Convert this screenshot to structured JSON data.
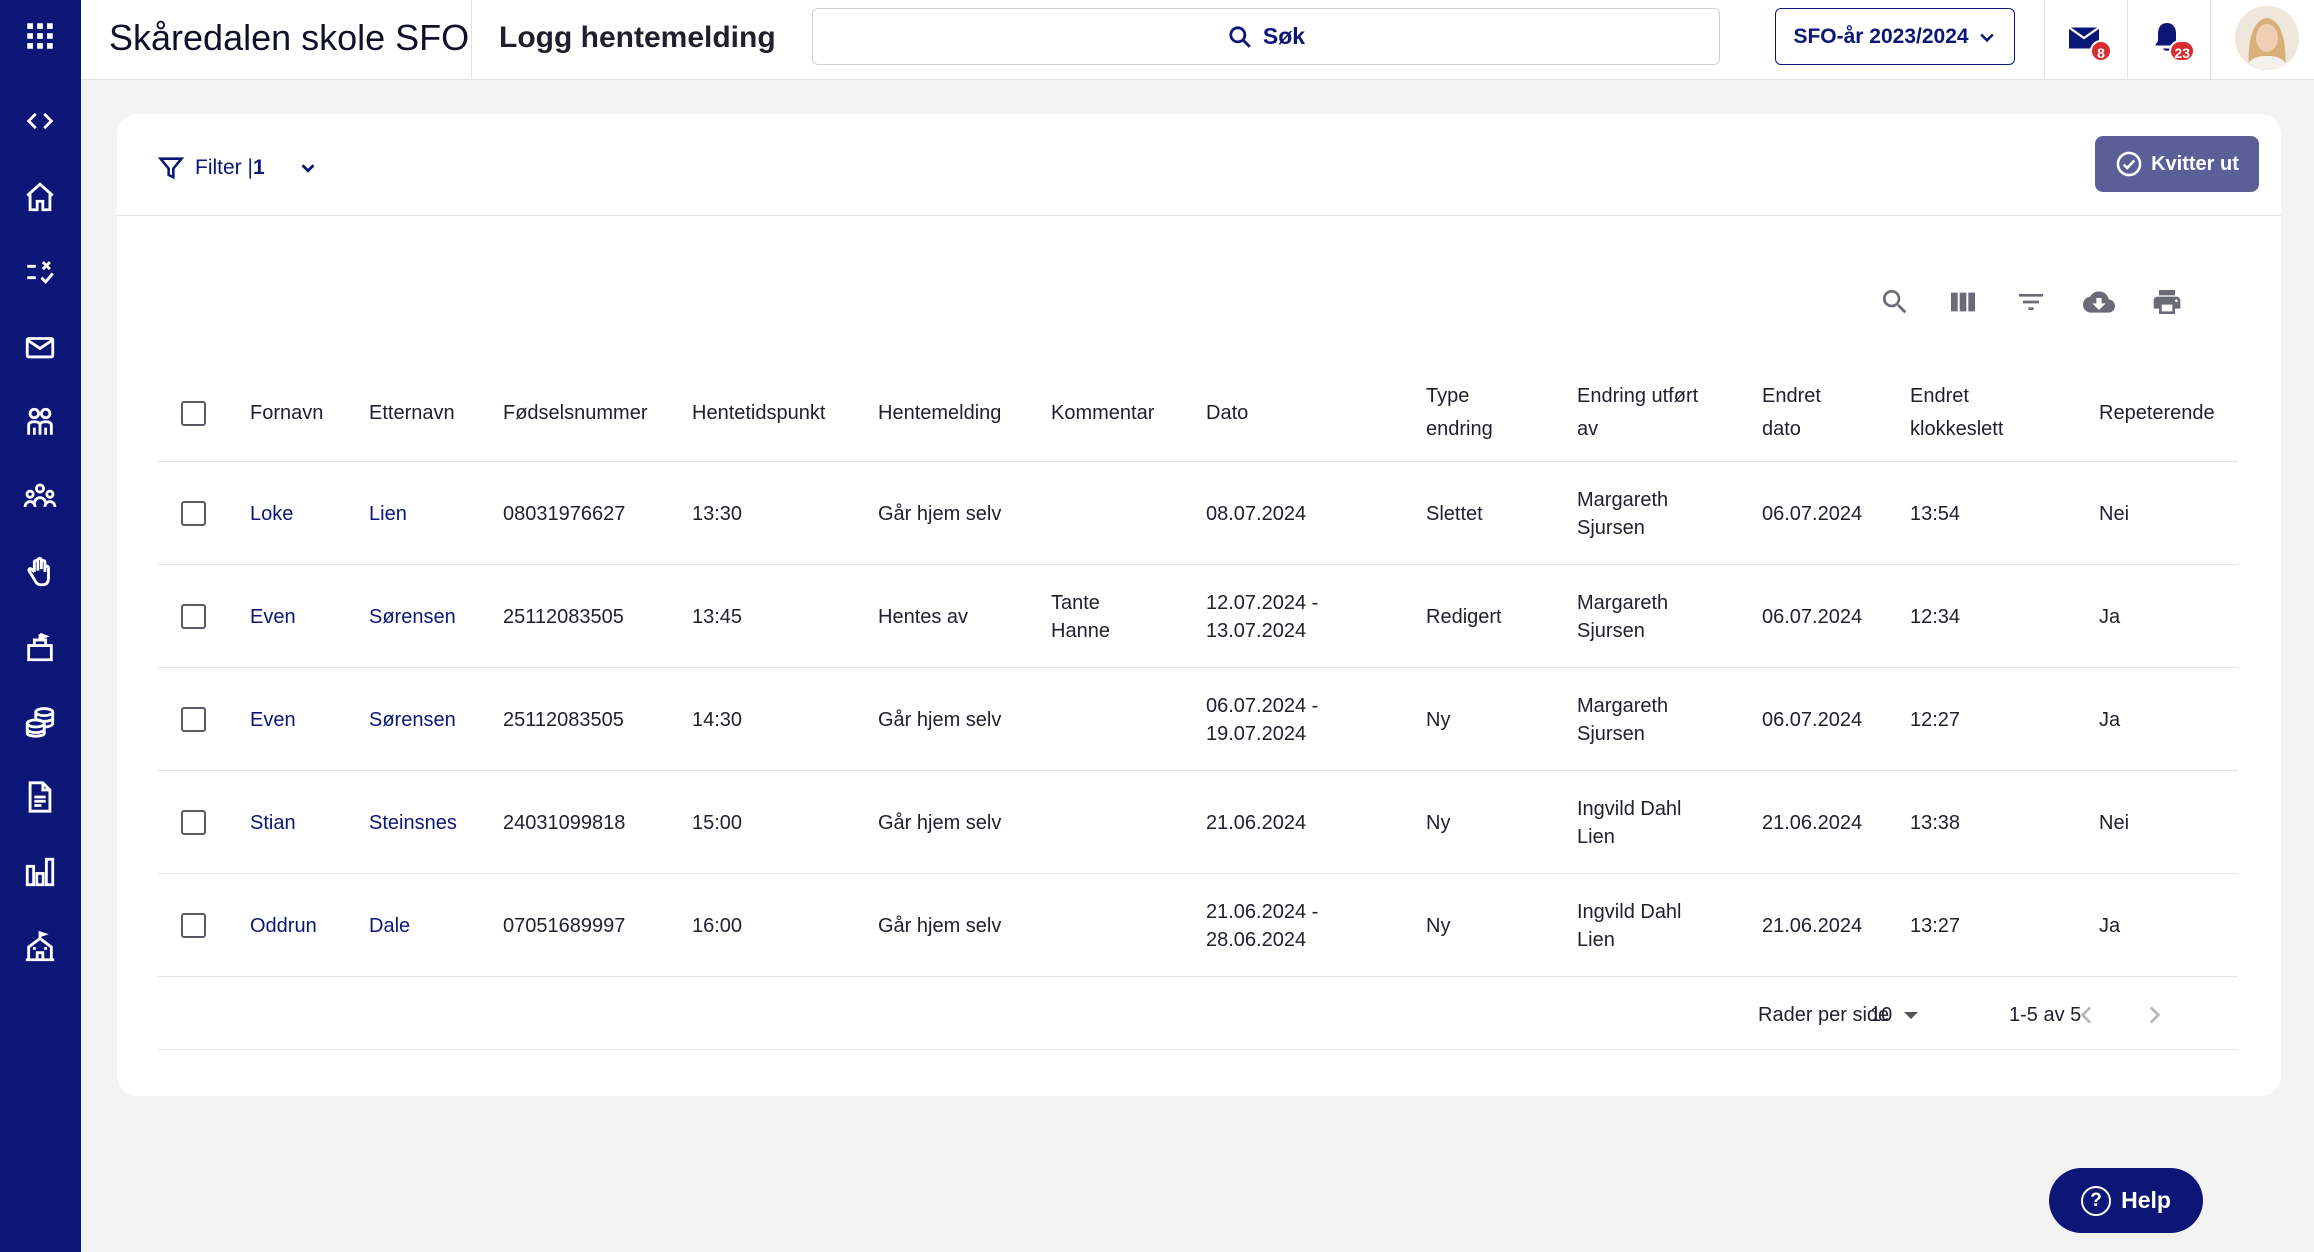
{
  "header": {
    "school_name": "Skåredalen skole SFO",
    "page_title": "Logg hentemelding",
    "search_label": "Søk",
    "year_selector": "SFO-år 2023/2024",
    "mail_badge": "8",
    "notifications_badge": "23"
  },
  "sidebar": {
    "items": [
      "expand-collapse",
      "home",
      "tasks",
      "messages",
      "children",
      "groups",
      "attendance",
      "departments",
      "payments",
      "documents",
      "reports",
      "school"
    ]
  },
  "toolbar": {
    "filter_label": "Filter |",
    "filter_count": "1",
    "kvitter_label": "Kvitter ut"
  },
  "table": {
    "columns": {
      "fornavn": "Fornavn",
      "etternavn": "Etternavn",
      "fodselsnummer": "Fødselsnummer",
      "hentetidspunkt": "Hentetidspunkt",
      "hentemelding": "Hentemelding",
      "kommentar": "Kommentar",
      "dato": "Dato",
      "type_endring": "Type endring",
      "endring_utfort_av": "Endring utført av",
      "endret_dato": "Endret dato",
      "endret_klokkeslett": "Endret klokkeslett",
      "repeterende": "Repeterende"
    },
    "rows": [
      {
        "fornavn": "Loke",
        "etternavn": "Lien",
        "fodselsnummer": "08031976627",
        "hentetidspunkt": "13:30",
        "hentemelding": "Går hjem selv",
        "kommentar": "",
        "dato": "08.07.2024",
        "type_endring": "Slettet",
        "endring_utfort_av": "Margareth Sjursen",
        "endret_dato": "06.07.2024",
        "endret_klokkeslett": "13:54",
        "repeterende": "Nei"
      },
      {
        "fornavn": "Even",
        "etternavn": "Sørensen",
        "fodselsnummer": "25112083505",
        "hentetidspunkt": "13:45",
        "hentemelding": "Hentes av",
        "kommentar": "Tante Hanne",
        "dato": "12.07.2024 - 13.07.2024",
        "type_endring": "Redigert",
        "endring_utfort_av": "Margareth Sjursen",
        "endret_dato": "06.07.2024",
        "endret_klokkeslett": "12:34",
        "repeterende": "Ja"
      },
      {
        "fornavn": "Even",
        "etternavn": "Sørensen",
        "fodselsnummer": "25112083505",
        "hentetidspunkt": "14:30",
        "hentemelding": "Går hjem selv",
        "kommentar": "",
        "dato": "06.07.2024 - 19.07.2024",
        "type_endring": "Ny",
        "endring_utfort_av": "Margareth Sjursen",
        "endret_dato": "06.07.2024",
        "endret_klokkeslett": "12:27",
        "repeterende": "Ja"
      },
      {
        "fornavn": "Stian",
        "etternavn": "Steinsnes",
        "fodselsnummer": "24031099818",
        "hentetidspunkt": "15:00",
        "hentemelding": "Går hjem selv",
        "kommentar": "",
        "dato": "21.06.2024",
        "type_endring": "Ny",
        "endring_utfort_av": "Ingvild Dahl Lien",
        "endret_dato": "21.06.2024",
        "endret_klokkeslett": "13:38",
        "repeterende": "Nei"
      },
      {
        "fornavn": "Oddrun",
        "etternavn": "Dale",
        "fodselsnummer": "07051689997",
        "hentetidspunkt": "16:00",
        "hentemelding": "Går hjem selv",
        "kommentar": "",
        "dato": "21.06.2024 - 28.06.2024",
        "type_endring": "Ny",
        "endring_utfort_av": "Ingvild Dahl Lien",
        "endret_dato": "21.06.2024",
        "endret_klokkeslett": "13:27",
        "repeterende": "Ja"
      }
    ]
  },
  "pagination": {
    "rows_per_page_label": "Rader per side",
    "rows_per_page_value": "10",
    "range": "1-5 av 5"
  },
  "help": {
    "label": "Help"
  },
  "colors": {
    "brand_navy": "#0c1677",
    "kvitter_button": "#5b5f98",
    "badge_red": "#d72f2f",
    "background": "#f3f3f4"
  }
}
